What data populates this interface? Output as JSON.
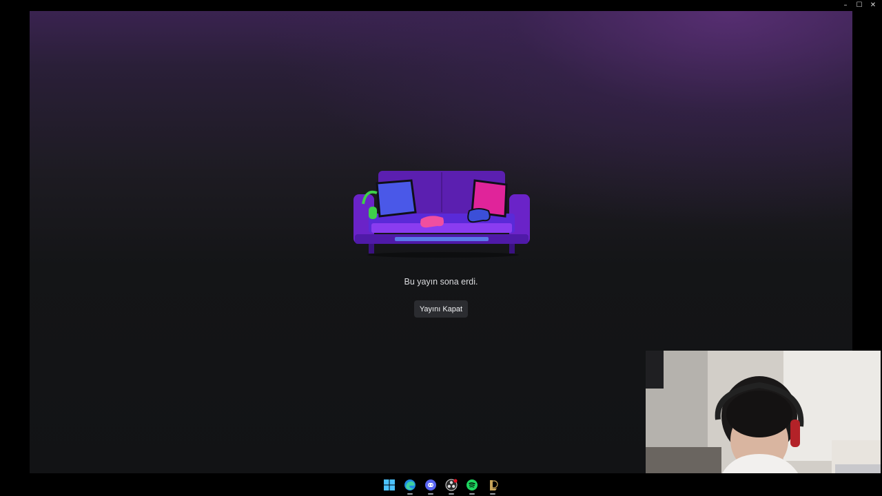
{
  "window": {
    "controls": {
      "minimize": "–",
      "maximize": "☐",
      "close": "✕"
    }
  },
  "stream": {
    "message": "Bu yayın sona erdi.",
    "close_button_label": "Yayını Kapat"
  },
  "colors": {
    "sofa_main": "#6a23c8",
    "sofa_back": "#5b1fb0",
    "sofa_seat": "#8a3cf0",
    "pillow_left": "#4a58e8",
    "pillow_right": "#e0249a",
    "headphones": "#3fcf4a",
    "controller_left": "#f04fa0",
    "controller_right": "#3b4fd8"
  },
  "taskbar": {
    "apps": [
      {
        "name": "windows-start-icon",
        "running": false
      },
      {
        "name": "edge-browser-icon",
        "running": true
      },
      {
        "name": "discord-icon",
        "running": true
      },
      {
        "name": "obs-icon",
        "running": true
      },
      {
        "name": "spotify-icon",
        "running": true
      },
      {
        "name": "league-client-icon",
        "running": true
      }
    ]
  }
}
